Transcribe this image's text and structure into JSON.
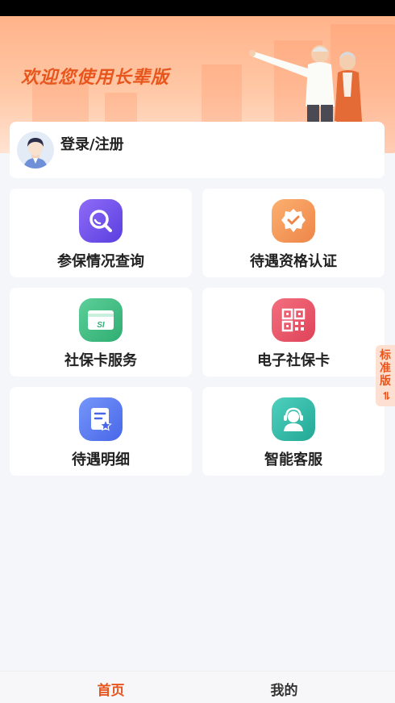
{
  "banner": {
    "title": "欢迎您使用长辈版"
  },
  "login": {
    "label": "登录/注册"
  },
  "tiles": [
    {
      "label": "参保情况查询",
      "icon": "search-icon",
      "color": "#7b5cf0"
    },
    {
      "label": "待遇资格认证",
      "icon": "certify-badge-icon",
      "color": "#f39a55"
    },
    {
      "label": "社保卡服务",
      "icon": "social-card-icon",
      "color": "#3dbb82"
    },
    {
      "label": "电子社保卡",
      "icon": "qr-code-icon",
      "color": "#ea5568"
    },
    {
      "label": "待遇明细",
      "icon": "document-star-icon",
      "color": "#5b7cf5"
    },
    {
      "label": "智能客服",
      "icon": "customer-service-icon",
      "color": "#2ab7a6"
    }
  ],
  "mode_switch": {
    "chars": [
      "标",
      "准",
      "版",
      "⇌"
    ]
  },
  "bottom_nav": {
    "items": [
      {
        "label": "首页",
        "active": true
      },
      {
        "label": "我的",
        "active": false
      }
    ],
    "active_color": "#e8561e",
    "inactive_color": "#333333"
  }
}
